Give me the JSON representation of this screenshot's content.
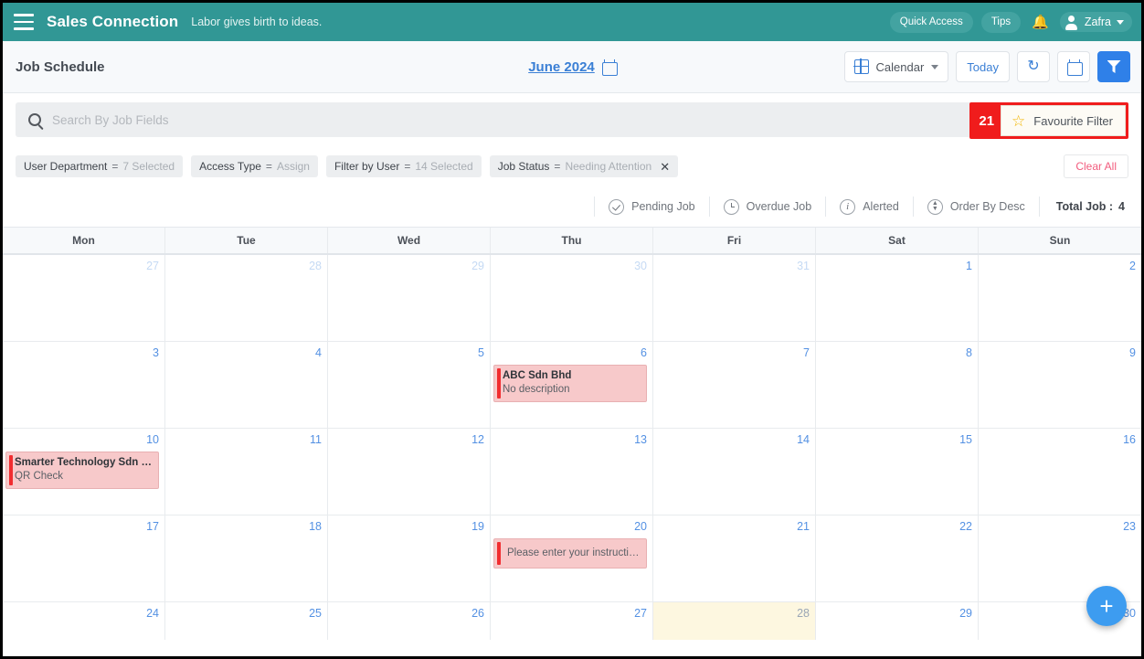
{
  "topbar": {
    "menu_icon": "hamburger-icon",
    "brand": "Sales Connection",
    "tagline": "Labor gives birth to ideas.",
    "quick_access": "Quick Access",
    "tips": "Tips",
    "bell_icon": "bell-icon",
    "user_name": "Zafra"
  },
  "toolbar": {
    "page_title": "Job Schedule",
    "month_label": "June 2024",
    "calendar_view": "Calendar",
    "today": "Today",
    "refresh_icon": "refresh-icon",
    "date_picker_icon": "calendar-icon",
    "filter_icon": "funnel-icon"
  },
  "search": {
    "placeholder": "Search By Job Fields",
    "value": "",
    "search_icon": "search-icon"
  },
  "annotation": {
    "number": "21",
    "accent_color": "#f01c1c"
  },
  "favourite_filter": {
    "label": "Favourite Filter",
    "star_icon": "star-icon"
  },
  "chips": [
    {
      "label": "User Department",
      "eq": "=",
      "value": "7 Selected",
      "removable": false
    },
    {
      "label": "Access Type",
      "eq": "=",
      "value": "Assign",
      "removable": false
    },
    {
      "label": "Filter by User",
      "eq": "=",
      "value": "14 Selected",
      "removable": false
    },
    {
      "label": "Job Status",
      "eq": "=",
      "value": "Needing Attention",
      "removable": true
    }
  ],
  "clear_all": "Clear All",
  "legend": [
    {
      "label": "Pending Job",
      "icon": "check-circle-icon"
    },
    {
      "label": "Overdue Job",
      "icon": "clock-circle-icon"
    },
    {
      "label": "Alerted",
      "icon": "info-circle-icon"
    },
    {
      "label": "Order By Desc",
      "icon": "sort-circle-icon"
    }
  ],
  "total_job": {
    "label": "Total Job :",
    "value": "4"
  },
  "calendar": {
    "day_headers": [
      "Mon",
      "Tue",
      "Wed",
      "Thu",
      "Fri",
      "Sat",
      "Sun"
    ],
    "weeks": [
      [
        {
          "num": "27",
          "other_month": true,
          "today": false,
          "events": []
        },
        {
          "num": "28",
          "other_month": true,
          "today": false,
          "events": []
        },
        {
          "num": "29",
          "other_month": true,
          "today": false,
          "events": []
        },
        {
          "num": "30",
          "other_month": true,
          "today": false,
          "events": []
        },
        {
          "num": "31",
          "other_month": true,
          "today": false,
          "events": []
        },
        {
          "num": "1",
          "other_month": false,
          "today": false,
          "events": []
        },
        {
          "num": "2",
          "other_month": false,
          "today": false,
          "events": []
        }
      ],
      [
        {
          "num": "3",
          "other_month": false,
          "today": false,
          "events": []
        },
        {
          "num": "4",
          "other_month": false,
          "today": false,
          "events": []
        },
        {
          "num": "5",
          "other_month": false,
          "today": false,
          "events": []
        },
        {
          "num": "6",
          "other_month": false,
          "today": false,
          "events": [
            {
              "title": "ABC Sdn Bhd",
              "desc": "No description"
            }
          ]
        },
        {
          "num": "7",
          "other_month": false,
          "today": false,
          "events": []
        },
        {
          "num": "8",
          "other_month": false,
          "today": false,
          "events": []
        },
        {
          "num": "9",
          "other_month": false,
          "today": false,
          "events": []
        }
      ],
      [
        {
          "num": "10",
          "other_month": false,
          "today": false,
          "events": [
            {
              "title": "Smarter Technology Sdn Bh...",
              "desc": "QR Check"
            }
          ]
        },
        {
          "num": "11",
          "other_month": false,
          "today": false,
          "events": []
        },
        {
          "num": "12",
          "other_month": false,
          "today": false,
          "events": []
        },
        {
          "num": "13",
          "other_month": false,
          "today": false,
          "events": []
        },
        {
          "num": "14",
          "other_month": false,
          "today": false,
          "events": []
        },
        {
          "num": "15",
          "other_month": false,
          "today": false,
          "events": []
        },
        {
          "num": "16",
          "other_month": false,
          "today": false,
          "events": []
        }
      ],
      [
        {
          "num": "17",
          "other_month": false,
          "today": false,
          "events": []
        },
        {
          "num": "18",
          "other_month": false,
          "today": false,
          "events": []
        },
        {
          "num": "19",
          "other_month": false,
          "today": false,
          "events": []
        },
        {
          "num": "20",
          "other_month": false,
          "today": false,
          "events": [
            {
              "title": "",
              "desc": "Please enter your instruction..."
            }
          ]
        },
        {
          "num": "21",
          "other_month": false,
          "today": false,
          "events": []
        },
        {
          "num": "22",
          "other_month": false,
          "today": false,
          "events": []
        },
        {
          "num": "23",
          "other_month": false,
          "today": false,
          "events": []
        }
      ],
      [
        {
          "num": "24",
          "other_month": false,
          "today": false,
          "events": []
        },
        {
          "num": "25",
          "other_month": false,
          "today": false,
          "events": []
        },
        {
          "num": "26",
          "other_month": false,
          "today": false,
          "events": []
        },
        {
          "num": "27",
          "other_month": false,
          "today": false,
          "events": []
        },
        {
          "num": "28",
          "other_month": false,
          "today": true,
          "events": []
        },
        {
          "num": "29",
          "other_month": false,
          "today": false,
          "events": []
        },
        {
          "num": "30",
          "other_month": false,
          "today": false,
          "events": []
        }
      ]
    ]
  },
  "fab": {
    "icon": "plus-icon",
    "label": "+"
  }
}
